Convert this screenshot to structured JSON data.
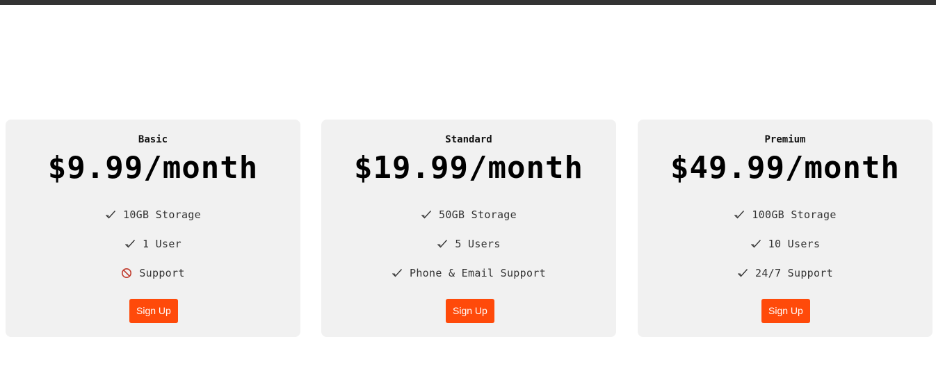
{
  "colors": {
    "top_bar": "#333333",
    "card_background": "#f1f1f1",
    "button_background": "#ff4a0a",
    "button_text": "#ffffff",
    "check_icon": "#333333",
    "no_icon": "#c0392b"
  },
  "plans": [
    {
      "name": "Basic",
      "price": "$9.99/month",
      "features": [
        {
          "text": "10GB Storage",
          "icon": "check-icon"
        },
        {
          "text": "1 User",
          "icon": "check-icon"
        },
        {
          "text": "Support",
          "icon": "prohibited-icon"
        }
      ],
      "button_label": "Sign Up"
    },
    {
      "name": "Standard",
      "price": "$19.99/month",
      "features": [
        {
          "text": "50GB Storage",
          "icon": "check-icon"
        },
        {
          "text": "5 Users",
          "icon": "check-icon"
        },
        {
          "text": "Phone & Email Support",
          "icon": "check-icon"
        }
      ],
      "button_label": "Sign Up"
    },
    {
      "name": "Premium",
      "price": "$49.99/month",
      "features": [
        {
          "text": "100GB Storage",
          "icon": "check-icon"
        },
        {
          "text": "10 Users",
          "icon": "check-icon"
        },
        {
          "text": "24/7 Support",
          "icon": "check-icon"
        }
      ],
      "button_label": "Sign Up"
    }
  ]
}
